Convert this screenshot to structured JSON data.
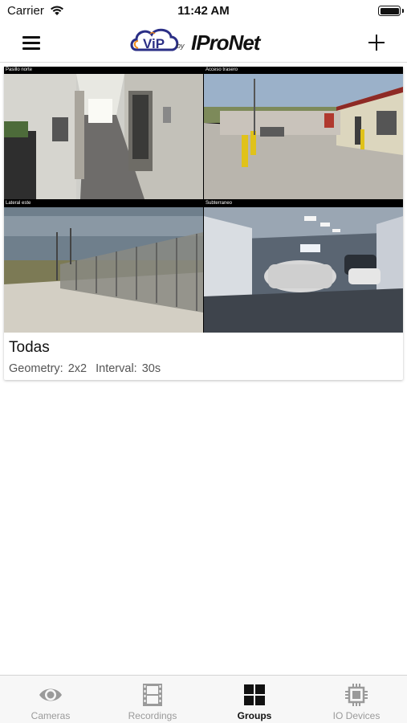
{
  "status_bar": {
    "carrier": "Carrier",
    "time": "11:42 AM"
  },
  "nav": {
    "logo_by": "by",
    "logo_brand": "IProNet",
    "logo_vip": "ViP",
    "menu_icon": "hamburger-menu-icon",
    "add_icon": "plus-icon"
  },
  "group": {
    "name": "Todas",
    "geometry_label": "Geometry:",
    "geometry_value": "2x2",
    "interval_label": "Interval:",
    "interval_value": "30s",
    "cameras": [
      {
        "label": "Pasillo norte"
      },
      {
        "label": "Acceso trasero"
      },
      {
        "label": "Lateral este"
      },
      {
        "label": "Subterraneo"
      }
    ]
  },
  "tabs": [
    {
      "label": "Cameras",
      "icon": "eye-icon",
      "active": false
    },
    {
      "label": "Recordings",
      "icon": "film-icon",
      "active": false
    },
    {
      "label": "Groups",
      "icon": "grid-icon",
      "active": true
    },
    {
      "label": "IO Devices",
      "icon": "chip-icon",
      "active": false
    }
  ],
  "colors": {
    "active_tab": "#111111",
    "inactive_tab": "#9a9a9a",
    "tab_bar_bg": "#f7f7f7"
  }
}
